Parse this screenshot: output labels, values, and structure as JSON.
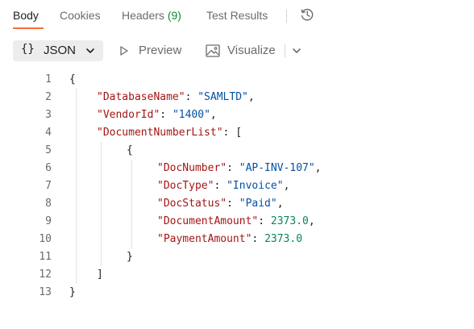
{
  "tabs": {
    "body": "Body",
    "cookies": "Cookies",
    "headers": "Headers",
    "headers_count": "(9)",
    "test_results": "Test Results"
  },
  "toolbar": {
    "json_braces": "{}",
    "json_label": "JSON",
    "preview_label": "Preview",
    "visualize_label": "Visualize"
  },
  "code": {
    "line_numbers": [
      "1",
      "2",
      "3",
      "4",
      "5",
      "6",
      "7",
      "8",
      "9",
      "10",
      "11",
      "12",
      "13"
    ],
    "open_brace": "{",
    "close_brace": "}",
    "open_bracket": "[",
    "close_bracket": "]",
    "database_name_key": "\"DatabaseName\"",
    "database_name_value": "\"SAMLTD\"",
    "vendor_id_key": "\"VendorId\"",
    "vendor_id_value": "\"1400\"",
    "document_number_list_key": "\"DocumentNumberList\"",
    "doc_number_key": "\"DocNumber\"",
    "doc_number_value": "\"AP-INV-107\"",
    "doc_type_key": "\"DocType\"",
    "doc_type_value": "\"Invoice\"",
    "doc_status_key": "\"DocStatus\"",
    "doc_status_value": "\"Paid\"",
    "document_amount_key": "\"DocumentAmount\"",
    "document_amount_value": "2373.0",
    "payment_amount_key": "\"PaymentAmount\"",
    "payment_amount_value": "2373.0",
    "colon": ": ",
    "comma": ","
  },
  "colors": {
    "accent": "#ff6c37",
    "key": "#a31515",
    "string": "#0451a5",
    "number": "#098658",
    "count": "#0f8a3b"
  }
}
